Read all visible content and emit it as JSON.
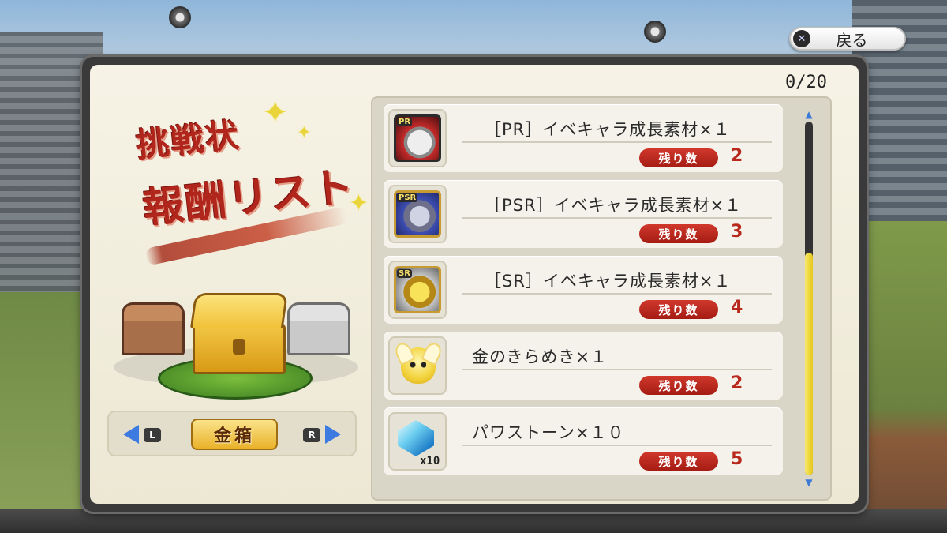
{
  "header": {
    "back_label": "戻る",
    "back_key": "✕"
  },
  "title": {
    "line1": "挑戦状",
    "line2": "報酬リスト"
  },
  "counter": "0/20",
  "selector": {
    "left_key": "L",
    "right_key": "R",
    "current_box": "金箱"
  },
  "rewards": [
    {
      "name": "［PR］イベキャラ成長素材×１",
      "remain_label": "残り数",
      "remain": "2",
      "icon": "pr-card-icon",
      "badge": "PR"
    },
    {
      "name": "［PSR］イベキャラ成長素材×１",
      "remain_label": "残り数",
      "remain": "3",
      "icon": "psr-card-icon",
      "badge": "PSR"
    },
    {
      "name": "［SR］イベキャラ成長素材×１",
      "remain_label": "残り数",
      "remain": "4",
      "icon": "sr-card-icon",
      "badge": "SR"
    },
    {
      "name": "金のきらめき×１",
      "remain_label": "残り数",
      "remain": "2",
      "icon": "gold-sparkle-fairy-icon"
    },
    {
      "name": "パワストーン×１０",
      "remain_label": "残り数",
      "remain": "5",
      "icon": "powerstone-gem-icon",
      "qty": "x10"
    }
  ],
  "scroll": {
    "thumb_start": 0.37,
    "thumb_end": 1.0
  },
  "colors": {
    "accent_red": "#b8281c",
    "badge_red": "#d0382b",
    "scroll_thumb": "#f2dc3a",
    "arrow_blue": "#3d7be0"
  }
}
